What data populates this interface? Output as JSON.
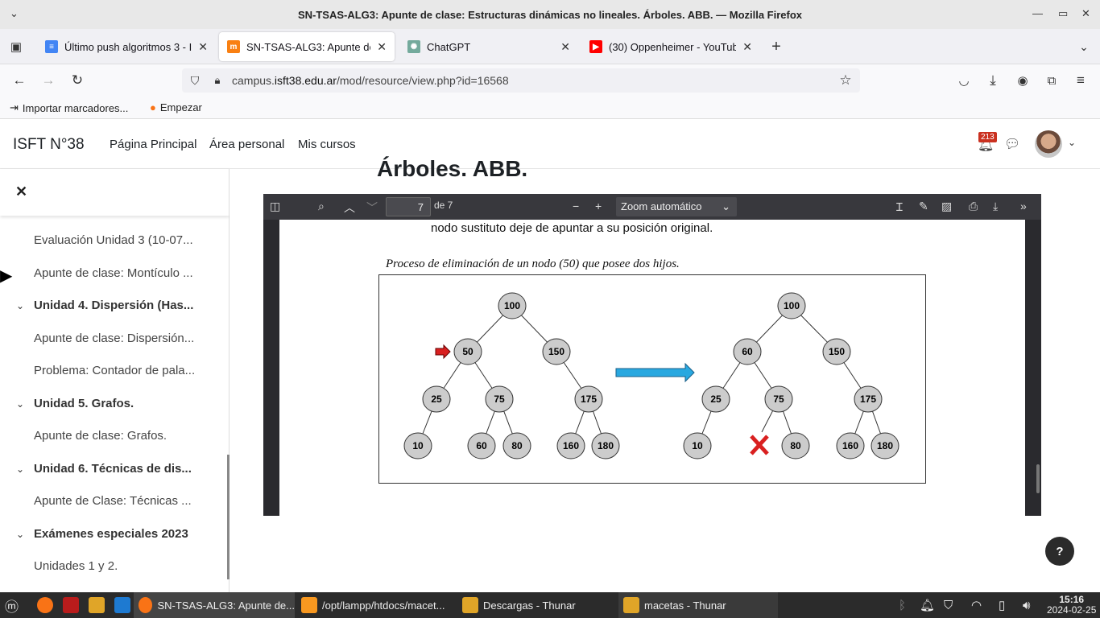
{
  "window": {
    "title": "SN-TSAS-ALG3: Apunte de clase: Estructuras dinámicas no lineales. Árboles. ABB. — Mozilla Firefox"
  },
  "tabs": [
    {
      "label": "Último push algoritmos 3 - I",
      "color": "#4285f4"
    },
    {
      "label": "SN-TSAS-ALG3: Apunte de cl",
      "color": "#f98012"
    },
    {
      "label": "ChatGPT",
      "color": "#74aa9c"
    },
    {
      "label": "(30) Oppenheimer - YouTub",
      "color": "#ff0000"
    }
  ],
  "address": {
    "host_prefix": "campus.",
    "host": "isft38.edu.ar",
    "path": "/mod/resource/view.php?id=16568"
  },
  "bookmarks": [
    {
      "label": "Importar marcadores..."
    },
    {
      "label": "Empezar"
    }
  ],
  "site": {
    "brand": "ISFT N°38",
    "nav": [
      "Página Principal",
      "Área personal",
      "Mis cursos"
    ],
    "notif_count": "213"
  },
  "drawer": {
    "items": [
      {
        "type": "item",
        "label": "Evaluación Unidad 3 (10-07..."
      },
      {
        "type": "item",
        "label": "Apunte de clase: Montículo ..."
      },
      {
        "type": "section",
        "label": "Unidad 4. Dispersión (Has..."
      },
      {
        "type": "item",
        "label": "Apunte de clase: Dispersión..."
      },
      {
        "type": "item",
        "label": "Problema: Contador de pala..."
      },
      {
        "type": "section",
        "label": "Unidad 5. Grafos."
      },
      {
        "type": "item",
        "label": "Apunte de clase: Grafos."
      },
      {
        "type": "section",
        "label": "Unidad 6. Técnicas de dis..."
      },
      {
        "type": "item",
        "label": "Apunte de Clase: Técnicas ..."
      },
      {
        "type": "section",
        "label": "Exámenes especiales 2023"
      },
      {
        "type": "item",
        "label": "Unidades 1 y 2."
      }
    ]
  },
  "page": {
    "heading_partial": "Árboles. ABB."
  },
  "pdf": {
    "page_current": "7",
    "page_total_label": "de 7",
    "zoom": "Zoom automático",
    "text_line": "nodo sustituto deje de apuntar a su posición original.",
    "caption": "Proceso de eliminación de un nodo (50) que posee dos hijos.",
    "tree_before": {
      "nodes": [
        "100",
        "50",
        "150",
        "25",
        "75",
        "175",
        "10",
        "60",
        "80",
        "160",
        "180"
      ]
    },
    "tree_after": {
      "nodes": [
        "100",
        "60",
        "150",
        "25",
        "75",
        "175",
        "10",
        "80",
        "160",
        "180"
      ]
    }
  },
  "taskbar": {
    "windows": [
      "SN-TSAS-ALG3: Apunte de...",
      "/opt/lampp/htdocs/macet...",
      "Descargas - Thunar",
      "macetas - Thunar"
    ],
    "time": "15:16",
    "date": "2024-02-25"
  },
  "colors": {
    "accent_blue": "#29a8e0",
    "red": "#d92020",
    "node_fill": "#cccccc"
  }
}
